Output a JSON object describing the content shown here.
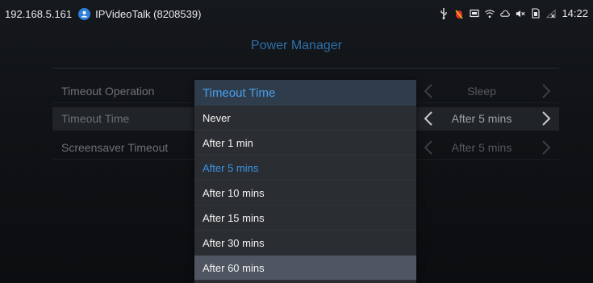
{
  "status_bar": {
    "ip": "192.168.5.161",
    "app_name": "IPVideoTalk (8208539)",
    "time": "14:22",
    "icons": [
      "usb-icon",
      "debug-icon",
      "cast-icon",
      "wifi-icon",
      "cloud-icon",
      "mute-icon",
      "sim-icon",
      "no-signal-icon"
    ]
  },
  "page": {
    "title": "Power Manager"
  },
  "settings": [
    {
      "label": "Timeout Operation",
      "value": "Sleep",
      "selected": false
    },
    {
      "label": "Timeout Time",
      "value": "After 5 mins",
      "selected": true
    },
    {
      "label": "Screensaver Timeout",
      "value": "After 5 mins",
      "selected": false
    }
  ],
  "dropdown": {
    "title": "Timeout Time",
    "options": [
      {
        "label": "Never",
        "state": "normal"
      },
      {
        "label": "After 1 min",
        "state": "normal"
      },
      {
        "label": "After 5 mins",
        "state": "active"
      },
      {
        "label": "After 10 mins",
        "state": "normal"
      },
      {
        "label": "After 15 mins",
        "state": "normal"
      },
      {
        "label": "After 30 mins",
        "state": "normal"
      },
      {
        "label": "After 60 mins",
        "state": "focus"
      }
    ]
  },
  "colors": {
    "accent": "#48a0ee",
    "title": "#2f6fa8",
    "dropdown_bg": "#2a2d31",
    "focus_bg": "#4f5661"
  }
}
